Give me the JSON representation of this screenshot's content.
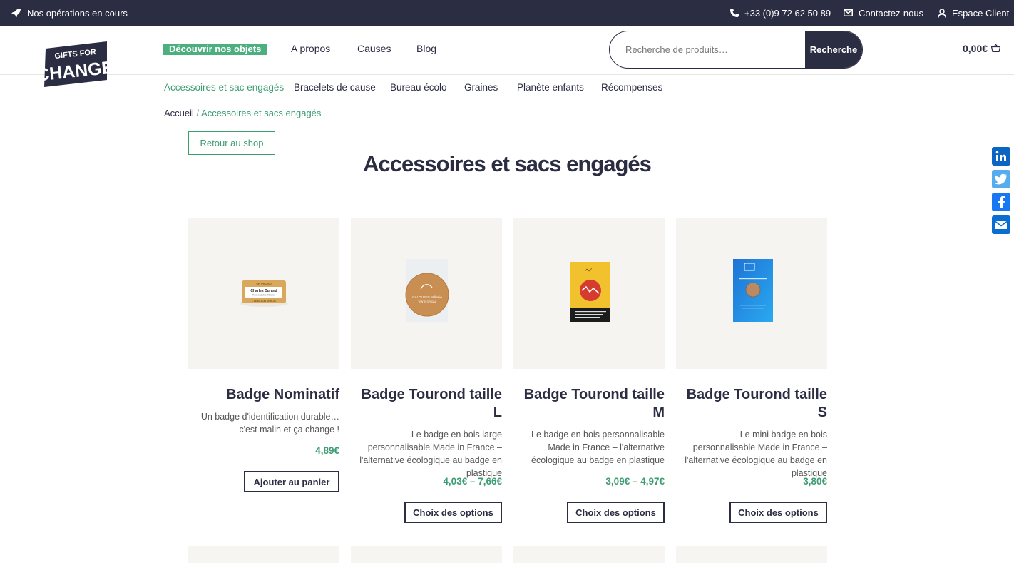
{
  "topbar": {
    "ops_label": "Nos opérations en cours",
    "phone": "+33 (0)9 72 62 50 89",
    "contact": "Contactez-nous",
    "account": "Espace Client"
  },
  "logo": {
    "line1": "GIFTS FOR",
    "line2": "CHANGE"
  },
  "nav": {
    "highlight": "Découvrir nos objets",
    "items": [
      "A propos",
      "Causes",
      "Blog"
    ]
  },
  "search": {
    "placeholder": "Recherche de produits…",
    "button": "Recherche"
  },
  "cart": {
    "total": "0,00€"
  },
  "categories": [
    "Accessoires et sac engagés",
    "Bracelets de cause",
    "Bureau écolo",
    "Graines",
    "Planète enfants",
    "Récompenses"
  ],
  "breadcrumb": {
    "home": "Accueil",
    "separator": " / ",
    "current": "Accessoires et sacs engagés"
  },
  "back_button": "Retour au shop",
  "page_title": "Accessoires et sacs engagés",
  "social": [
    "linkedin-icon",
    "twitter-icon",
    "facebook-icon",
    "email-icon"
  ],
  "products": [
    {
      "name": "Badge Nominatif",
      "description": "Un badge d'identification durable… c'est malin et ça change !",
      "price": "4,89€",
      "action": "Ajouter au panier",
      "badge_text": {
        "top": "ON PROMO",
        "name": "Charles Durand",
        "role": "Responsable Mission",
        "bottom": "1 DEMI-TON VERDIX"
      }
    },
    {
      "name": "Badge Tourond taille L",
      "description": "Le badge en bois large personnalisable Made in France – l'alternative écologique au badge en plastique",
      "price": "4,03€ – 7,66€",
      "action": "Choix des options",
      "badge_text": {
        "line1": "GALOUBES Mélanie",
        "line2": "TENTE ORIGAL"
      }
    },
    {
      "name": "Badge Tourond taille M",
      "description": "Le badge en bois personnalisable Made in France – l'alternative écologique au badge en plastique",
      "price": "3,09€ – 4,97€",
      "action": "Choix des options"
    },
    {
      "name": "Badge Tourond taille S",
      "description": "Le mini badge en bois personnalisable Made in France – l'alternative écologique au badge en plastique",
      "price": "3,80€",
      "action": "Choix des options"
    }
  ]
}
